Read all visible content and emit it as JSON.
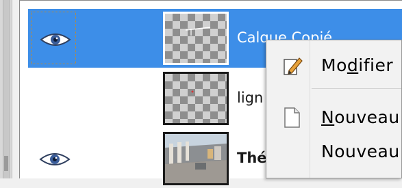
{
  "layers": [
    {
      "name": "Calque Copié",
      "visible": true,
      "selected": true
    },
    {
      "name": "lign",
      "visible": false,
      "selected": false
    },
    {
      "name": "Thé",
      "visible": true,
      "selected": false
    }
  ],
  "context_menu": {
    "items": [
      {
        "pre": "Mo",
        "mnemonic": "d",
        "post": "ifier",
        "icon": "edit-pencil-icon"
      },
      {
        "pre": "",
        "mnemonic": "N",
        "post": "ouveau",
        "icon": "new-document-icon"
      },
      {
        "pre": "",
        "mnemonic": "",
        "post": "Nouveau",
        "icon": ""
      }
    ]
  },
  "colors": {
    "selection": "#3d8ee8",
    "focus_outline": "#c58a2a",
    "menu_bg": "#f2f2f2"
  }
}
